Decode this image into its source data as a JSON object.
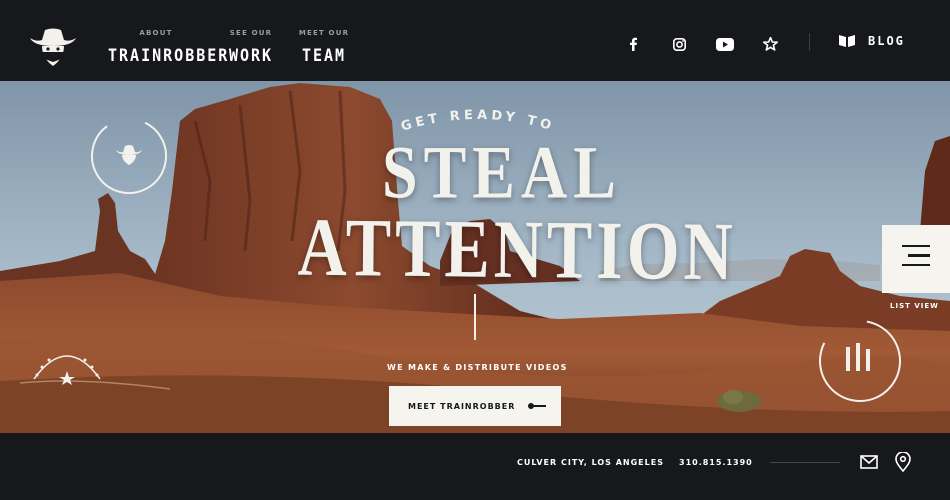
{
  "header": {
    "logo_icon": "cowboy-bandit-icon",
    "nav": [
      {
        "small": "ABOUT",
        "big": "TRAINROBBER"
      },
      {
        "small": "SEE OUR",
        "big": "WORK"
      },
      {
        "small": "MEET OUR",
        "big": "TEAM"
      }
    ],
    "social": [
      "facebook-icon",
      "instagram-icon",
      "youtube-icon",
      "star-icon"
    ],
    "blog_label": "BLOG",
    "blog_icon": "open-book-icon"
  },
  "hero": {
    "kicker": "GET READY TO",
    "title_line1": "STEAL",
    "title_line2": "ATTENTION",
    "tagline": "WE MAKE & DISTRIBUTE VIDEOS",
    "cta_label": "MEET TRAINROBBER",
    "list_view_label": "LIST VIEW",
    "menu_icon": "hamburger-menu-icon",
    "play_icon": "film-play-icon"
  },
  "footer": {
    "location": "CULVER CITY, LOS ANGELES",
    "phone": "310.815.1390",
    "mail_icon": "envelope-icon",
    "map_icon": "map-pin-icon"
  },
  "colors": {
    "bar": "#17181c",
    "light": "#f6f4ef",
    "rock": "#7a3a24",
    "sky": "#9fb4c6"
  }
}
